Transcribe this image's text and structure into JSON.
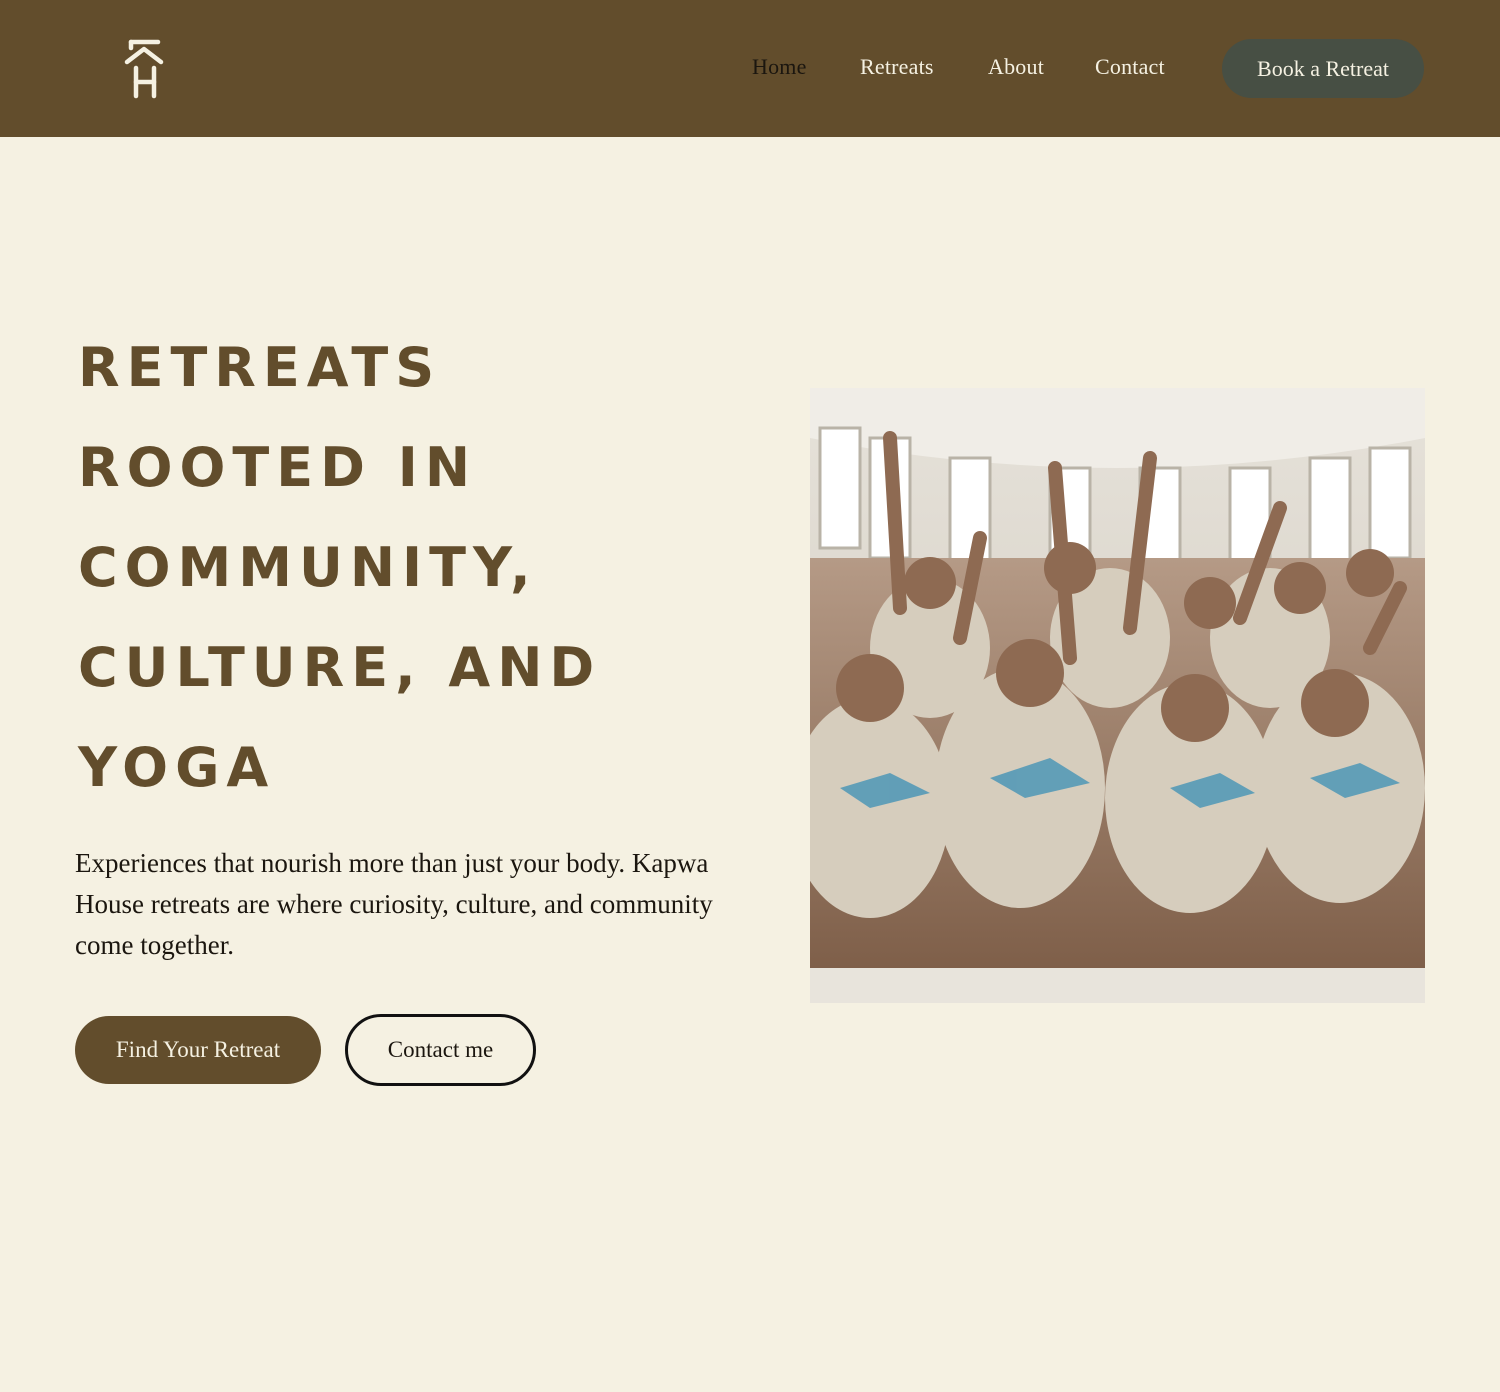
{
  "header": {
    "logo_icon": "kh-house-logo-icon",
    "nav": [
      {
        "label": "Home",
        "active": true
      },
      {
        "label": "Retreats",
        "active": false
      },
      {
        "label": "About",
        "active": false
      },
      {
        "label": "Contact",
        "active": false
      }
    ],
    "cta_label": "Book a Retreat"
  },
  "hero": {
    "headline_lines": [
      "Retreats",
      "rooted in",
      "community,",
      "culture, and",
      "yoga"
    ],
    "subtext": "Experiences that nourish more than just your body. Kapwa House retreats are where curiosity, culture, and community come together.",
    "primary_button": "Find Your Retreat",
    "secondary_button": "Contact me"
  },
  "colors": {
    "brand_brown": "#624d2c",
    "background_cream": "#f5f1e2",
    "cta_green": "#474f44"
  }
}
